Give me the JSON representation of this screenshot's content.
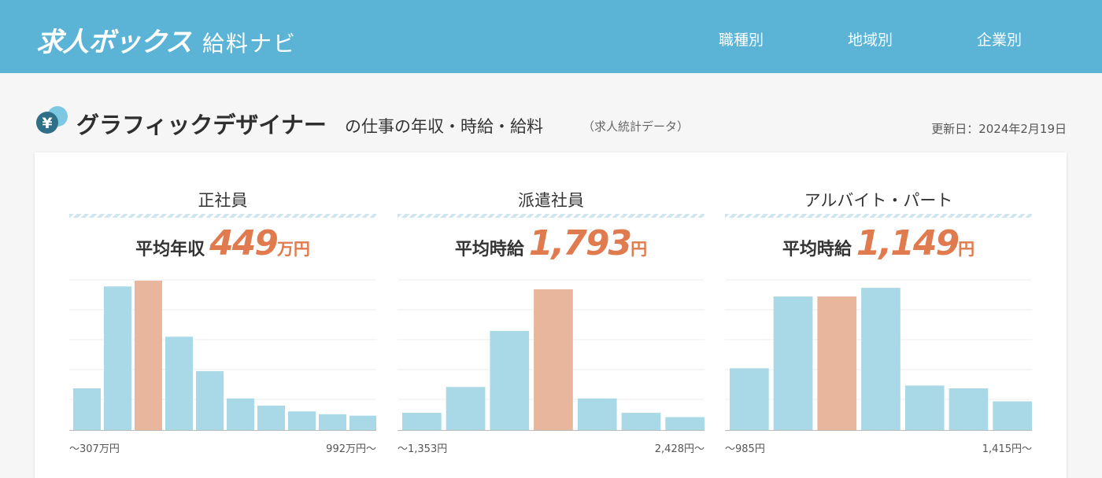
{
  "header": {
    "logo_main": "求人ボックス",
    "logo_sub": "給料ナビ",
    "nav": [
      {
        "label": "職種別"
      },
      {
        "label": "地域別"
      },
      {
        "label": "企業別"
      }
    ]
  },
  "page": {
    "title_main": "グラフィックデザイナー",
    "title_sub": "の仕事の年収・時給・給料",
    "title_note": "（求人統計データ）",
    "updated": "更新日：2024年2月19日",
    "icon": "yen-icon"
  },
  "colors": {
    "header": "#5bb4d6",
    "bar": "#a9d8e6",
    "bar_highlight": "#e8b69c",
    "accent": "#e07a4f"
  },
  "panels": [
    {
      "title": "正社員",
      "avg_label": "平均年収",
      "avg_value": "449",
      "avg_unit": "万円",
      "axis_min": "〜307万円",
      "axis_max": "992万円〜"
    },
    {
      "title": "派遣社員",
      "avg_label": "平均時給",
      "avg_value": "1,793",
      "avg_unit": "円",
      "axis_min": "〜1,353円",
      "axis_max": "2,428円〜"
    },
    {
      "title": "アルバイト・パート",
      "avg_label": "平均時給",
      "avg_value": "1,149",
      "avg_unit": "円",
      "axis_min": "〜985円",
      "axis_max": "1,415円〜"
    }
  ],
  "chart_data": [
    {
      "type": "bar",
      "values": [
        29,
        100,
        104,
        65,
        41,
        22,
        17,
        13,
        11,
        10
      ],
      "highlight_index": 2
    },
    {
      "type": "bar",
      "values": [
        12,
        30,
        69,
        98,
        22,
        12,
        9
      ],
      "highlight_index": 3
    },
    {
      "type": "bar",
      "values": [
        43,
        93,
        93,
        99,
        31,
        29,
        20
      ],
      "highlight_index": 2
    }
  ]
}
